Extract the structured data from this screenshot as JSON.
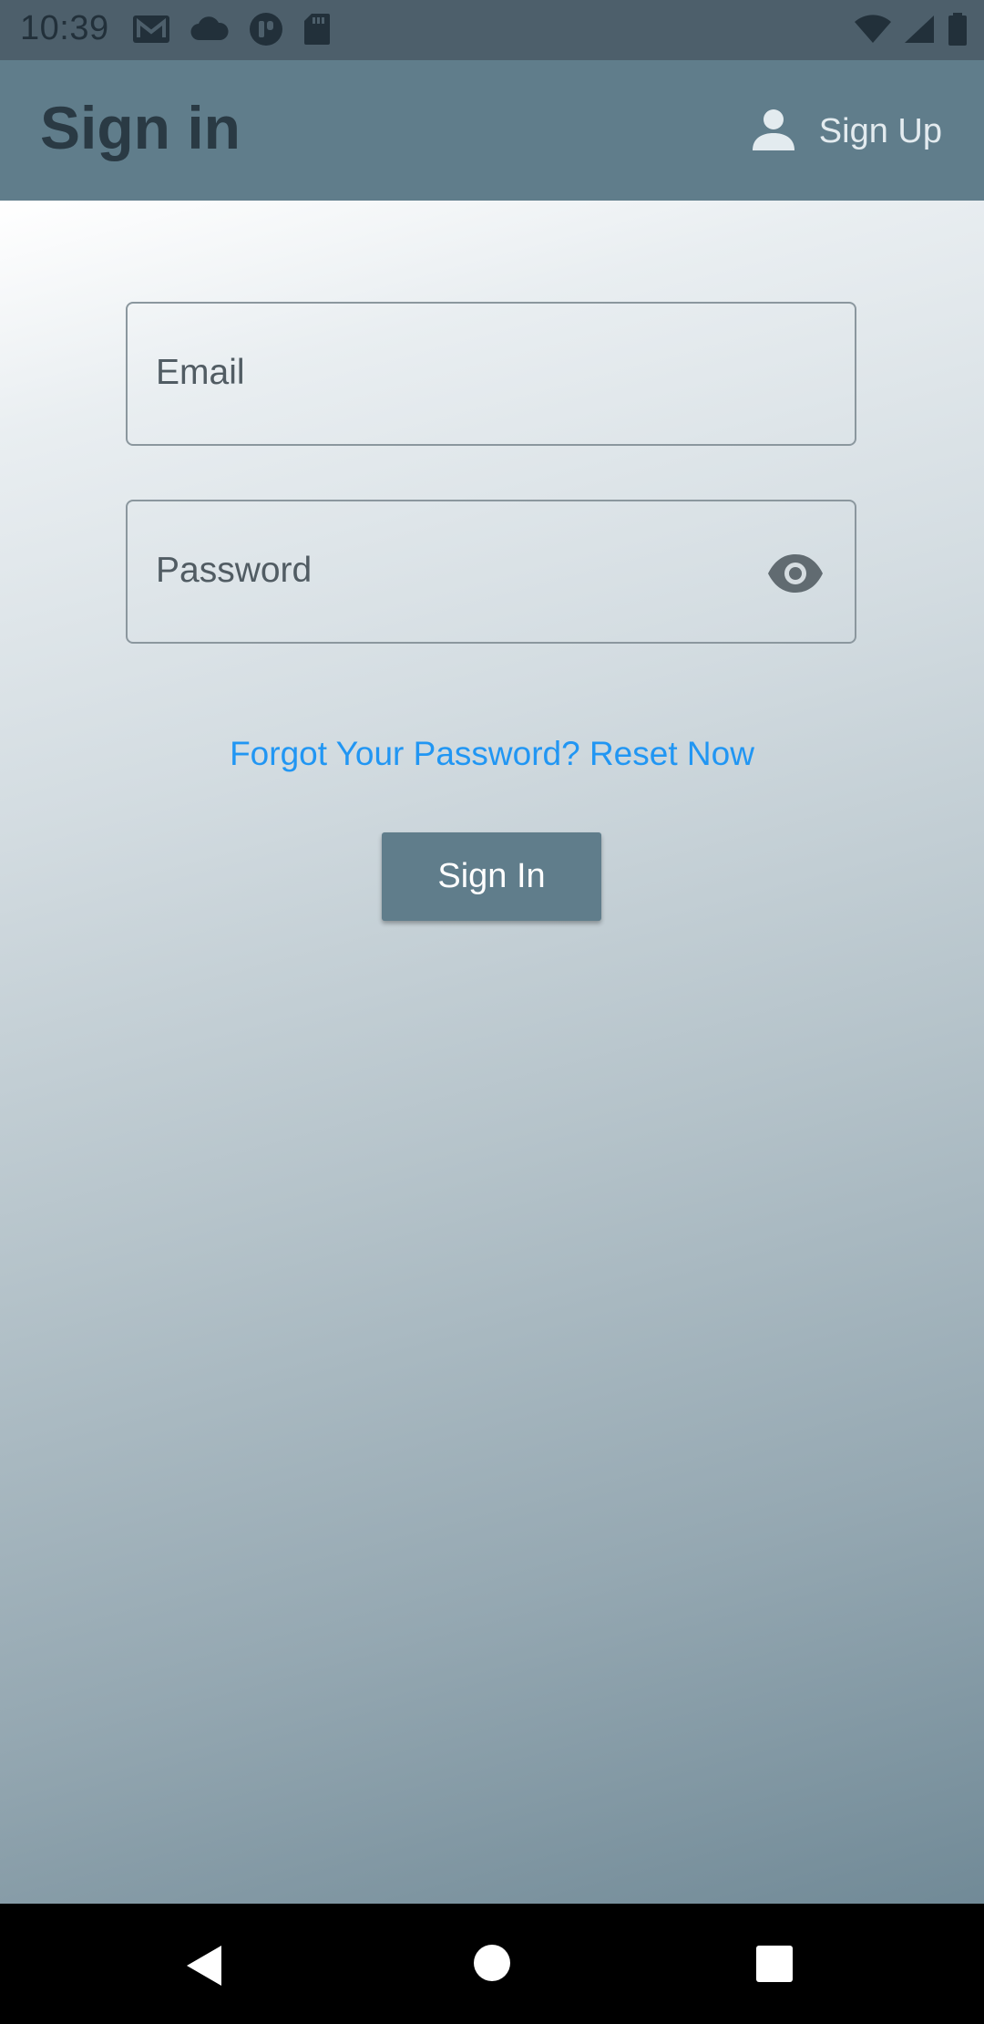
{
  "status_bar": {
    "time": "10:39",
    "left_icons": [
      "gmail-icon",
      "cloud-icon",
      "app-status-icon",
      "sd-card-icon"
    ],
    "right_icons": [
      "wifi-icon",
      "signal-icon",
      "battery-icon"
    ]
  },
  "app_bar": {
    "title": "Sign in",
    "action_label": "Sign Up",
    "action_icon": "person-icon",
    "background": "#607d8b"
  },
  "form": {
    "email_placeholder": "Email",
    "password_placeholder": "Password",
    "password_toggle_icon": "eye-icon",
    "forgot_link": "Forgot Your Password? Reset Now",
    "submit_label": "Sign In",
    "link_color": "#2196f3"
  },
  "nav_bar": {
    "buttons": [
      "back-icon",
      "home-icon",
      "recents-icon"
    ]
  }
}
